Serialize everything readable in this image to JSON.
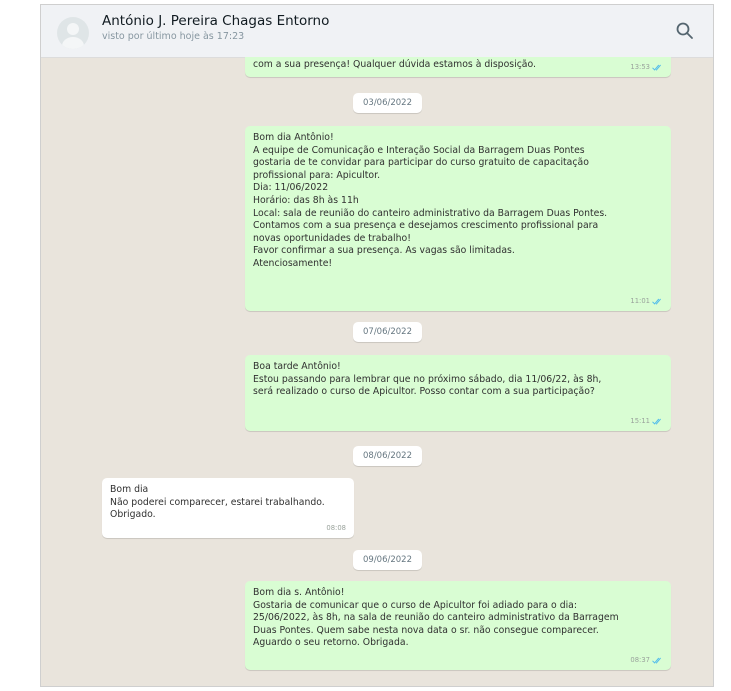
{
  "header": {
    "contact_name": "António J. Pereira Chagas Entorno",
    "last_seen": "visto por último hoje às 17:23"
  },
  "messages": [
    {
      "type": "out",
      "text": "com a sua presença! Qualquer dúvida estamos à disposição.",
      "time": "13:53"
    },
    {
      "type": "date",
      "text": "03/06/2022"
    },
    {
      "type": "out",
      "text": "Bom dia Antônio!\nA equipe de Comunicação e Interação Social da Barragem Duas Pontes\ngostaria de te convidar para participar do curso gratuito de capacitação\nprofissional para: Apicultor.\nDia: 11/06/2022\nHorário: das 8h às 11h\nLocal: sala de reunião do canteiro administrativo da Barragem Duas Pontes.\nContamos com a sua presença e desejamos crescimento profissional para\nnovas oportunidades de trabalho!\nFavor confirmar a sua presença. As vagas são limitadas.\nAtenciosamente!",
      "time": "11:01"
    },
    {
      "type": "date",
      "text": "07/06/2022"
    },
    {
      "type": "out",
      "text": "Boa tarde Antônio!\nEstou passando para lembrar que no próximo sábado, dia 11/06/22, às 8h,\nserá realizado o curso de Apicultor. Posso contar com a sua participação?",
      "time": "15:11"
    },
    {
      "type": "date",
      "text": "08/06/2022"
    },
    {
      "type": "in",
      "text": "Bom dia\nNão poderei comparecer, estarei trabalhando.\nObrigado.",
      "time": "08:08"
    },
    {
      "type": "date",
      "text": "09/06/2022"
    },
    {
      "type": "out",
      "text": "Bom dia s. Antônio!\nGostaria de comunicar que o curso de Apicultor foi adiado para o dia:\n25/06/2022, às 8h, na sala de reunião do canteiro administrativo da Barragem\nDuas Pontes. Quem sabe nesta nova data o sr. não consegue comparecer.\nAguardo o seu retorno. Obrigada.",
      "time": "08:37"
    }
  ]
}
